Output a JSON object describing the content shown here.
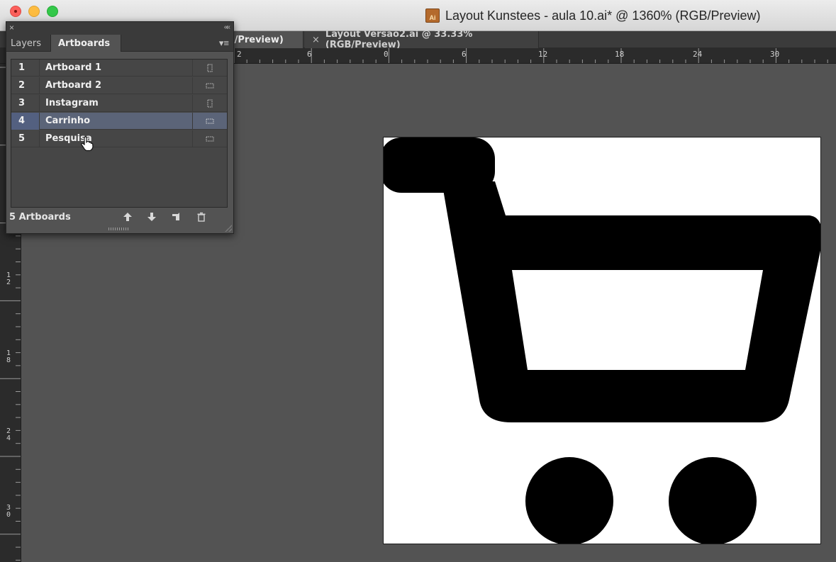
{
  "window": {
    "title": "Layout Kunstees - aula 10.ai* @ 1360% (RGB/Preview)"
  },
  "document_tabs": [
    {
      "label": "GB/Preview)",
      "active": true
    },
    {
      "label": "Layout Versão2.ai @ 33.33% (RGB/Preview)",
      "active": false,
      "close_glyph": "×"
    }
  ],
  "rulers": {
    "top_labels": [
      "2",
      "6",
      "0",
      "6",
      "12",
      "18",
      "24",
      "30"
    ],
    "left_labels": [
      [
        "1",
        "2"
      ],
      [
        "1",
        "8"
      ],
      [
        "2",
        "4"
      ],
      [
        "3",
        "0"
      ]
    ]
  },
  "panel": {
    "close_glyph": "×",
    "collapse_glyph": "««",
    "tabs": [
      "Layers",
      "Artboards"
    ],
    "active_tab": "Artboards",
    "menu_glyph": "▾≡",
    "artboards": [
      {
        "number": "1",
        "name": "Artboard 1",
        "selected": false,
        "orientation": "portrait"
      },
      {
        "number": "2",
        "name": "Artboard 2",
        "selected": false,
        "orientation": "landscape"
      },
      {
        "number": "3",
        "name": "Instagram",
        "selected": false,
        "orientation": "portrait"
      },
      {
        "number": "4",
        "name": "Carrinho",
        "selected": true,
        "orientation": "landscape"
      },
      {
        "number": "5",
        "name": "Pesquisa",
        "selected": false,
        "orientation": "landscape"
      }
    ],
    "footer": {
      "count_label": "5 Artboards",
      "buttons": [
        "move-up-icon",
        "move-down-icon",
        "new-artboard-icon",
        "delete-artboard-icon"
      ]
    }
  },
  "artwork": {
    "subject": "shopping-cart-icon",
    "fill": "#000000",
    "background": "#ffffff"
  },
  "colors": {
    "workspace": "#535353",
    "selection": "#5b6478"
  }
}
